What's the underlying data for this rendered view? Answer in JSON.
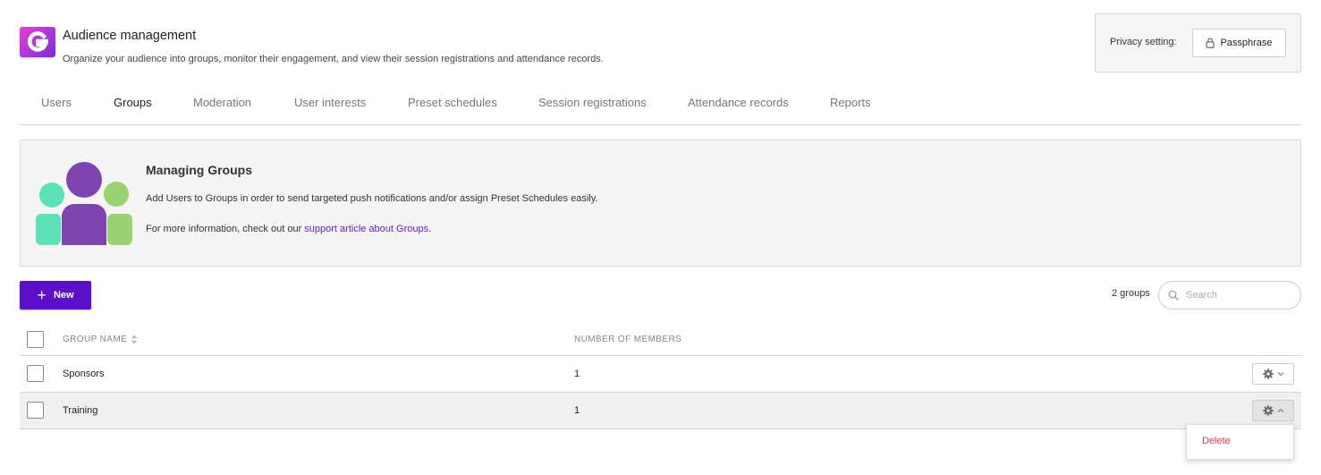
{
  "header": {
    "logo_icon": "g-logo-icon",
    "title": "Audience management",
    "subtitle": "Organize your audience into groups, monitor their engagement, and view their session registrations and attendance records."
  },
  "privacy": {
    "label": "Privacy setting:",
    "button_label": "Passphrase",
    "button_icon": "lock-icon"
  },
  "tabs": [
    {
      "label": "Users",
      "active": false
    },
    {
      "label": "Groups",
      "active": true
    },
    {
      "label": "Moderation",
      "active": false
    },
    {
      "label": "User interests",
      "active": false
    },
    {
      "label": "Preset schedules",
      "active": false
    },
    {
      "label": "Session registrations",
      "active": false
    },
    {
      "label": "Attendance records",
      "active": false
    },
    {
      "label": "Reports",
      "active": false
    }
  ],
  "info": {
    "title": "Managing Groups",
    "text1": "Add Users to Groups in order to send targeted push notifications and/or assign Preset Schedules easily.",
    "text2_prefix": "For more information, check out our ",
    "link_text": "support article about Groups",
    "text2_suffix": "."
  },
  "toolbar": {
    "new_label": "New",
    "group_count": "2 groups",
    "search_placeholder": "Search"
  },
  "table": {
    "columns": [
      "GROUP NAME",
      "NUMBER OF MEMBERS"
    ],
    "rows": [
      {
        "name": "Sponsors",
        "members": "1"
      },
      {
        "name": "Training",
        "members": "1"
      }
    ]
  },
  "dropdown": {
    "delete_label": "Delete"
  },
  "colors": {
    "primary": "#5b10c8",
    "link": "#6a1fb5",
    "danger": "#e5394b",
    "illus_purple": "#7e44b0",
    "illus_teal": "#5ee0b8",
    "illus_green": "#9bd273"
  }
}
